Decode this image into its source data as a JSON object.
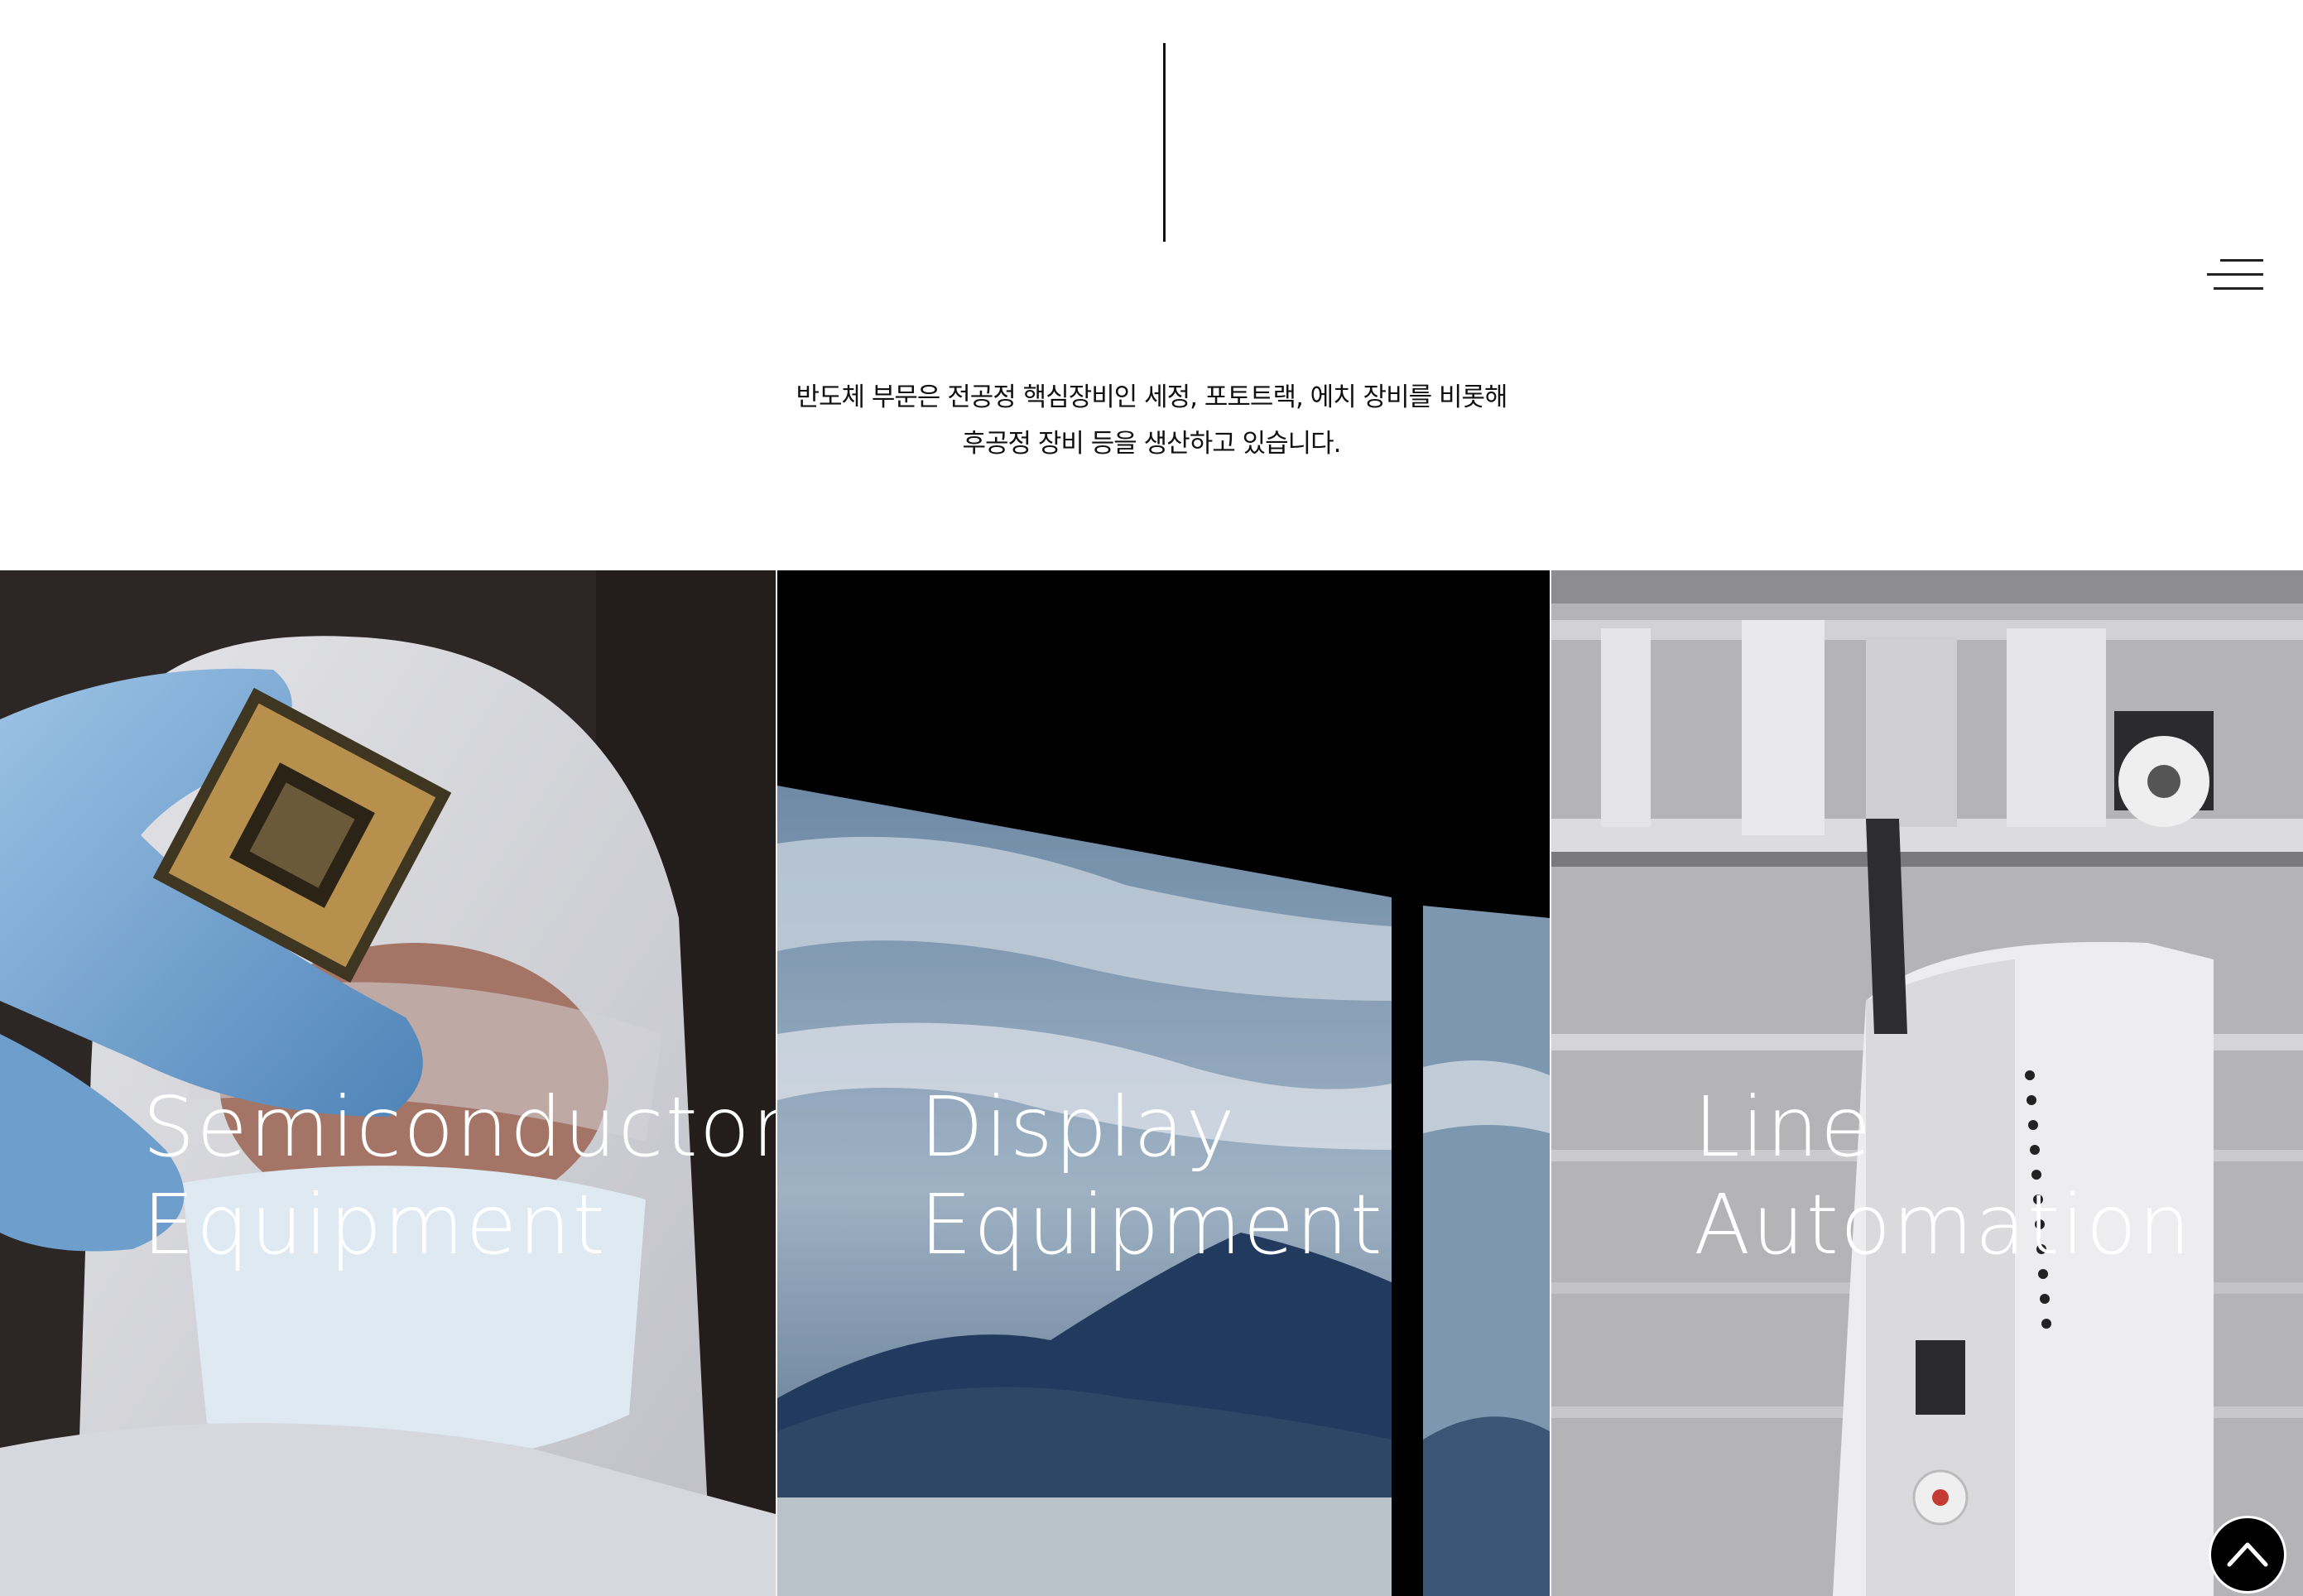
{
  "intro": {
    "line1": "반도체 부문은 전공정 핵심장비인 세정, 포토트랙, 에치 장비를 비롯해",
    "line2": "후공정 장비 등을 생산하고 있습니다."
  },
  "panels": [
    {
      "title_line1": "Semiconductor",
      "title_line2": "Equipment",
      "image": "cleanroom-worker-holding-cpu-chip"
    },
    {
      "title_line1": "Display",
      "title_line2": "Equipment",
      "image": "display-panels-mountain-landscape"
    },
    {
      "title_line1": "Line",
      "title_line2": "Automation",
      "image": "factory-overhead-transport-vehicle"
    }
  ],
  "icons": {
    "menu": "hamburger-menu-icon",
    "scroll_top": "chevron-up-icon"
  },
  "colors": {
    "text": "#111111",
    "panel_text": "#ffffff",
    "scroll_button": "#000000"
  }
}
